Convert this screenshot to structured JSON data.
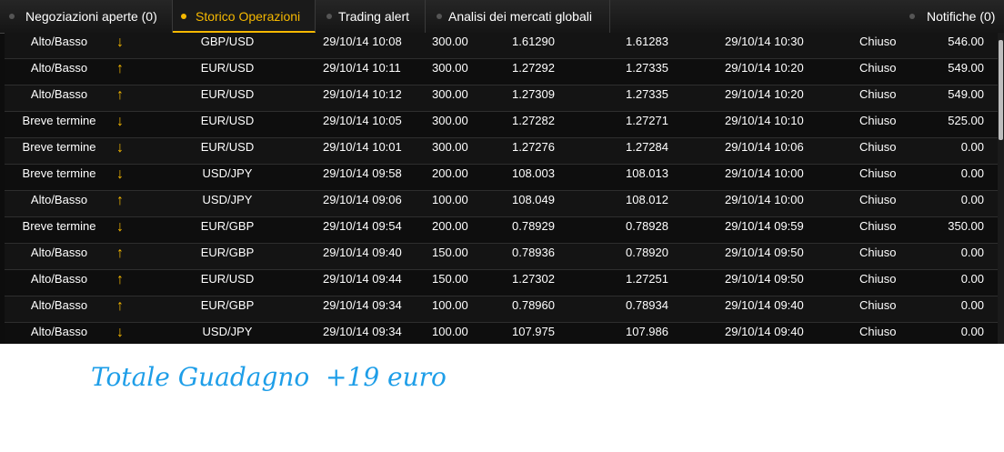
{
  "tabs": [
    {
      "label": "Negoziazioni aperte (0)",
      "active": false
    },
    {
      "label": "Storico Operazioni",
      "active": true
    },
    {
      "label": "Trading alert",
      "active": false
    },
    {
      "label": "Analisi dei mercati globali",
      "active": false
    }
  ],
  "notifications_label": "Notifiche (0)",
  "colors": {
    "accent": "#f5b800",
    "caption": "#1e9ee8",
    "panel_bg": "#0d0d0d"
  },
  "rows": [
    {
      "type": "Alto/Basso",
      "direction": "down",
      "asset": "GBP/USD",
      "open_time": "29/10/14 10:08",
      "amount": "300.00",
      "open_price": "1.61290",
      "close_price": "1.61283",
      "close_time": "29/10/14 10:30",
      "status": "Chiuso",
      "payout": "546.00"
    },
    {
      "type": "Alto/Basso",
      "direction": "up",
      "asset": "EUR/USD",
      "open_time": "29/10/14 10:11",
      "amount": "300.00",
      "open_price": "1.27292",
      "close_price": "1.27335",
      "close_time": "29/10/14 10:20",
      "status": "Chiuso",
      "payout": "549.00"
    },
    {
      "type": "Alto/Basso",
      "direction": "up",
      "asset": "EUR/USD",
      "open_time": "29/10/14 10:12",
      "amount": "300.00",
      "open_price": "1.27309",
      "close_price": "1.27335",
      "close_time": "29/10/14 10:20",
      "status": "Chiuso",
      "payout": "549.00"
    },
    {
      "type": "Breve termine",
      "direction": "down",
      "asset": "EUR/USD",
      "open_time": "29/10/14 10:05",
      "amount": "300.00",
      "open_price": "1.27282",
      "close_price": "1.27271",
      "close_time": "29/10/14 10:10",
      "status": "Chiuso",
      "payout": "525.00"
    },
    {
      "type": "Breve termine",
      "direction": "down",
      "asset": "EUR/USD",
      "open_time": "29/10/14 10:01",
      "amount": "300.00",
      "open_price": "1.27276",
      "close_price": "1.27284",
      "close_time": "29/10/14 10:06",
      "status": "Chiuso",
      "payout": "0.00"
    },
    {
      "type": "Breve termine",
      "direction": "down",
      "asset": "USD/JPY",
      "open_time": "29/10/14 09:58",
      "amount": "200.00",
      "open_price": "108.003",
      "close_price": "108.013",
      "close_time": "29/10/14 10:00",
      "status": "Chiuso",
      "payout": "0.00"
    },
    {
      "type": "Alto/Basso",
      "direction": "up",
      "asset": "USD/JPY",
      "open_time": "29/10/14 09:06",
      "amount": "100.00",
      "open_price": "108.049",
      "close_price": "108.012",
      "close_time": "29/10/14 10:00",
      "status": "Chiuso",
      "payout": "0.00"
    },
    {
      "type": "Breve termine",
      "direction": "down",
      "asset": "EUR/GBP",
      "open_time": "29/10/14 09:54",
      "amount": "200.00",
      "open_price": "0.78929",
      "close_price": "0.78928",
      "close_time": "29/10/14 09:59",
      "status": "Chiuso",
      "payout": "350.00"
    },
    {
      "type": "Alto/Basso",
      "direction": "up",
      "asset": "EUR/GBP",
      "open_time": "29/10/14 09:40",
      "amount": "150.00",
      "open_price": "0.78936",
      "close_price": "0.78920",
      "close_time": "29/10/14 09:50",
      "status": "Chiuso",
      "payout": "0.00"
    },
    {
      "type": "Alto/Basso",
      "direction": "up",
      "asset": "EUR/USD",
      "open_time": "29/10/14 09:44",
      "amount": "150.00",
      "open_price": "1.27302",
      "close_price": "1.27251",
      "close_time": "29/10/14 09:50",
      "status": "Chiuso",
      "payout": "0.00"
    },
    {
      "type": "Alto/Basso",
      "direction": "up",
      "asset": "EUR/GBP",
      "open_time": "29/10/14 09:34",
      "amount": "100.00",
      "open_price": "0.78960",
      "close_price": "0.78934",
      "close_time": "29/10/14 09:40",
      "status": "Chiuso",
      "payout": "0.00"
    },
    {
      "type": "Alto/Basso",
      "direction": "down",
      "asset": "USD/JPY",
      "open_time": "29/10/14 09:34",
      "amount": "100.00",
      "open_price": "107.975",
      "close_price": "107.986",
      "close_time": "29/10/14 09:40",
      "status": "Chiuso",
      "payout": "0.00"
    }
  ],
  "caption": "Totale Guadagno  +19 euro"
}
